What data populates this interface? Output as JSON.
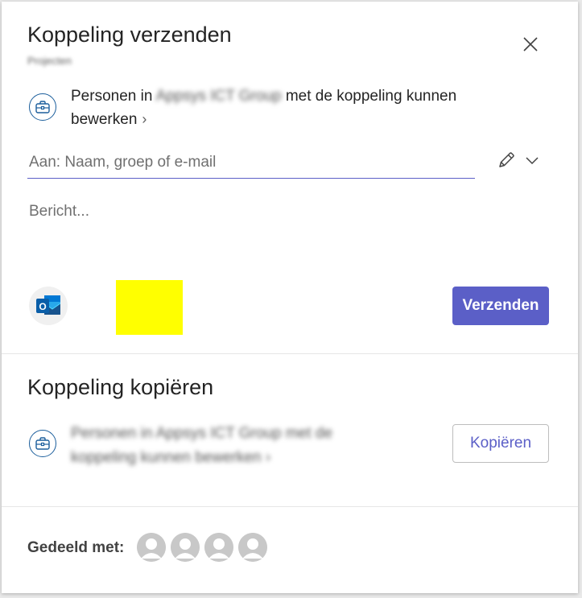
{
  "dialog": {
    "title": "Koppeling verzenden",
    "subtitle": "Projecten",
    "close_icon": "close-icon"
  },
  "send_section": {
    "permission": {
      "prefix": "Personen in ",
      "org": "Appsys ICT Group",
      "suffix": " met de koppeling kunnen bewerken",
      "chevron": "›",
      "icon": "briefcase-icon"
    },
    "to_placeholder": "Aan: Naam, groep of e-mail",
    "message_placeholder": "Bericht...",
    "outlook_label": "O",
    "send_label": "Verzenden",
    "colors": {
      "accent": "#5b5fc7",
      "icon_blue": "#1b5e9c",
      "redaction": "#ffff00"
    }
  },
  "copy_section": {
    "title": "Koppeling kopiëren",
    "permission_text": "Personen in Appsys ICT Group met de koppeling kunnen bewerken ›",
    "copy_label": "Kopiëren"
  },
  "shared": {
    "label": "Gedeeld met:",
    "avatars": [
      "avatar-1",
      "avatar-2",
      "avatar-3",
      "avatar-4"
    ]
  }
}
